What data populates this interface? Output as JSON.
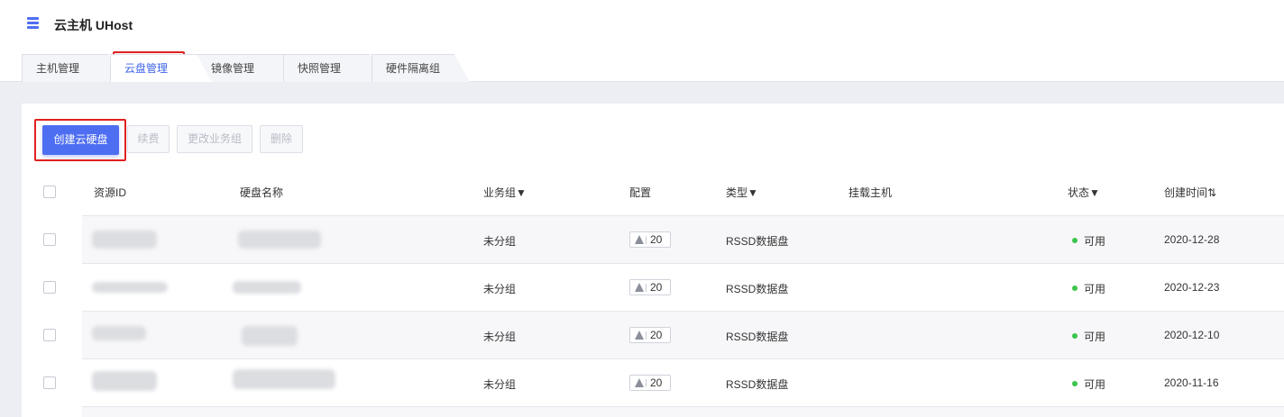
{
  "app": {
    "title": "云主机 UHost",
    "icon": "server-list-icon",
    "accent": "#4e6ef2"
  },
  "tabs": [
    {
      "label": "主机管理",
      "active": false
    },
    {
      "label": "云盘管理",
      "active": true
    },
    {
      "label": "镜像管理",
      "active": false
    },
    {
      "label": "快照管理",
      "active": false
    },
    {
      "label": "硬件隔离组",
      "active": false
    }
  ],
  "toolbar": {
    "create": "创建云硬盘",
    "renew": "续费",
    "change_group": "更改业务组",
    "delete": "删除"
  },
  "table": {
    "columns": [
      "资源ID",
      "硬盘名称",
      "业务组▼",
      "配置",
      "类型▼",
      "挂载主机",
      "状态▼",
      "创建时间⇅"
    ],
    "rows": [
      {
        "group": "未分组",
        "config": "20",
        "type": "RSSD数据盘",
        "host": "",
        "status": "可用",
        "created": "2020-12-28"
      },
      {
        "group": "未分组",
        "config": "20",
        "type": "RSSD数据盘",
        "host": "",
        "status": "可用",
        "created": "2020-12-23"
      },
      {
        "group": "未分组",
        "config": "20",
        "type": "RSSD数据盘",
        "host": "",
        "status": "可用",
        "created": "2020-12-10"
      },
      {
        "group": "未分组",
        "config": "20",
        "type": "RSSD数据盘",
        "host": "",
        "status": "可用",
        "created": "2020-11-16"
      }
    ]
  },
  "colors": {
    "status_ok": "#3bc44b",
    "highlight": "#e02020"
  }
}
